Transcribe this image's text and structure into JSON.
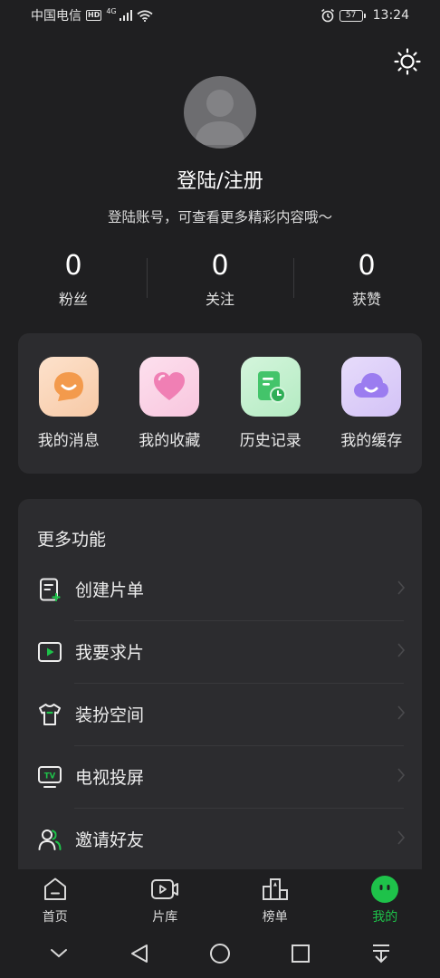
{
  "status_bar": {
    "carrier": "中国电信",
    "hd": "HD",
    "network": "4G",
    "battery": "57",
    "time": "13:24"
  },
  "profile": {
    "login_title": "登陆/注册",
    "login_subtitle": "登陆账号，可查看更多精彩内容哦～"
  },
  "stats": [
    {
      "value": "0",
      "label": "粉丝"
    },
    {
      "value": "0",
      "label": "关注"
    },
    {
      "value": "0",
      "label": "获赞"
    }
  ],
  "quick_actions": [
    {
      "label": "我的消息",
      "icon": "message-smile-icon",
      "color": "#f39a4c"
    },
    {
      "label": "我的收藏",
      "icon": "heart-icon",
      "color": "#f07fb4"
    },
    {
      "label": "历史记录",
      "icon": "history-icon",
      "color": "#43c46a"
    },
    {
      "label": "我的缓存",
      "icon": "cloud-icon",
      "color": "#9b7cf0"
    }
  ],
  "more": {
    "title": "更多功能",
    "items": [
      {
        "label": "创建片单",
        "icon": "create-list-icon"
      },
      {
        "label": "我要求片",
        "icon": "request-video-icon"
      },
      {
        "label": "装扮空间",
        "icon": "tshirt-icon"
      },
      {
        "label": "电视投屏",
        "icon": "tv-cast-icon"
      },
      {
        "label": "邀请好友",
        "icon": "invite-friends-icon"
      }
    ]
  },
  "tabs": [
    {
      "label": "首页",
      "icon": "home-icon"
    },
    {
      "label": "片库",
      "icon": "video-library-icon"
    },
    {
      "label": "榜单",
      "icon": "ranking-icon"
    },
    {
      "label": "我的",
      "icon": "profile-face-icon",
      "active": true
    }
  ],
  "colors": {
    "background": "#1f1f21",
    "card": "#2c2c2f",
    "accent": "#1ec24a"
  }
}
